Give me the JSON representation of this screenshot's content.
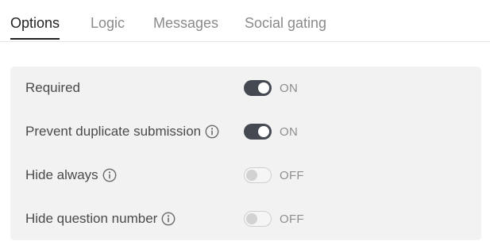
{
  "tabs": [
    {
      "label": "Options",
      "active": true
    },
    {
      "label": "Logic",
      "active": false
    },
    {
      "label": "Messages",
      "active": false
    },
    {
      "label": "Social gating",
      "active": false
    }
  ],
  "options": [
    {
      "label": "Required",
      "has_info": false,
      "toggle": "on",
      "state_label": "ON"
    },
    {
      "label": "Prevent duplicate submission",
      "has_info": true,
      "info_icon": "info-icon",
      "toggle": "on",
      "state_label": "ON"
    },
    {
      "label": "Hide always",
      "has_info": true,
      "info_icon": "info-icon",
      "toggle": "off",
      "state_label": "OFF"
    },
    {
      "label": "Hide question number",
      "has_info": true,
      "info_icon": "info-icon",
      "toggle": "off",
      "state_label": "OFF"
    }
  ],
  "colors": {
    "toggle_on": "#454a52",
    "toggle_off": "#f5f5f5",
    "panel_background": "#f2f2f2",
    "active_tab": "#222222",
    "inactive_tab": "#8a8a8a"
  }
}
